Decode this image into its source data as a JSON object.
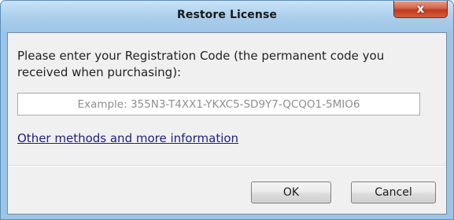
{
  "window": {
    "title": "Restore License",
    "close_glyph": "x"
  },
  "dialog": {
    "prompt": "Please enter your Registration Code (the permanent code you received when purchasing):",
    "code_placeholder": "Example: 355N3-T4XX1-YKXC5-SD9Y7-QCQO1-5MIO6",
    "code_value": "",
    "more_info_link": "Other methods and more information"
  },
  "buttons": {
    "ok_label": "OK",
    "cancel_label": "Cancel"
  },
  "colors": {
    "frame": "#9cc4e6",
    "close_button": "#c13a1f",
    "client_background": "#f0f0f0",
    "link": "#1f1f7a"
  }
}
